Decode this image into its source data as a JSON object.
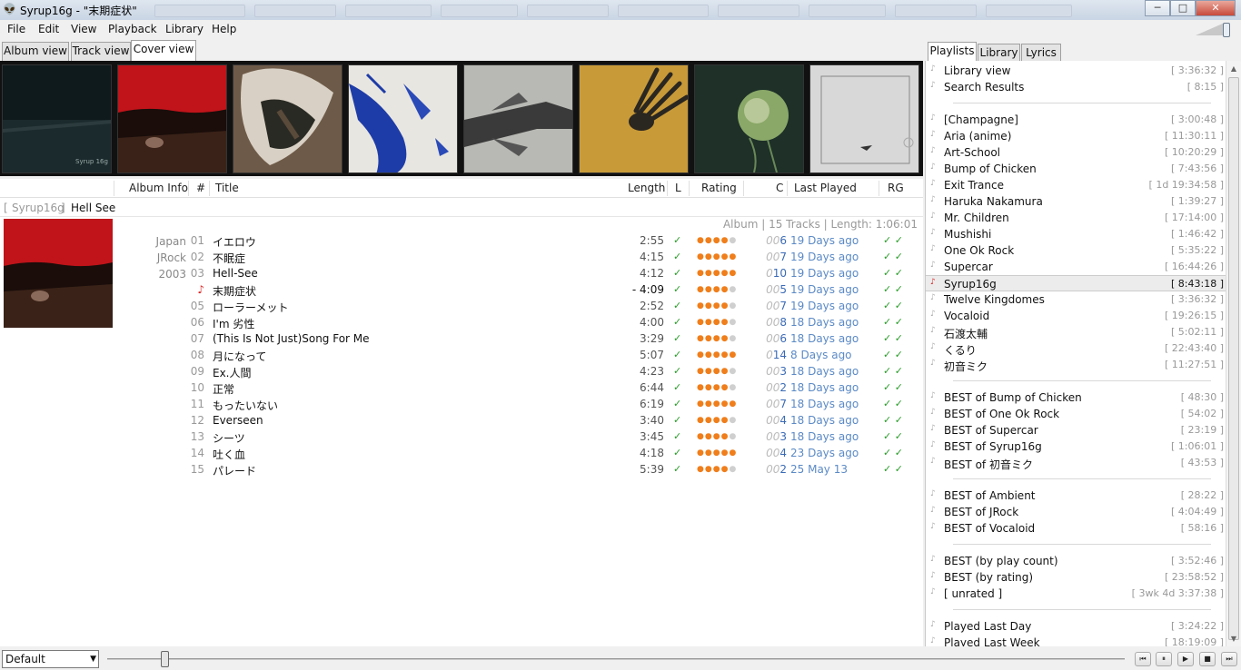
{
  "window": {
    "title": "Syrup16g  -  \"末期症状\"",
    "min": "─",
    "max": "□",
    "close": "✕"
  },
  "menu": [
    "File",
    "Edit",
    "View",
    "Playback",
    "Library",
    "Help"
  ],
  "tabs": [
    "Album view",
    "Track view",
    "Cover view"
  ],
  "active_tab": "Cover view",
  "columns": {
    "album_info": "Album Info",
    "num": "#",
    "title": "Title",
    "length": "Length",
    "l": "L",
    "rating": "Rating",
    "c": "C",
    "last_played": "Last Played",
    "rg": "RG"
  },
  "group": {
    "artist": "Syrup16g",
    "album": "Hell See",
    "left_bracket": "[",
    "right_bracket": "]"
  },
  "album_summary": "Album  |  15 Tracks  |  Length: 1:06:01",
  "album_meta": [
    "Japan",
    "JRock",
    "2003"
  ],
  "tracks": [
    {
      "n": "01",
      "title": "イエロウ",
      "len": "2:55",
      "stars": 4,
      "cz": "00",
      "c": "6",
      "lp": "19 Days ago"
    },
    {
      "n": "02",
      "title": "不眠症",
      "len": "4:15",
      "stars": 5,
      "cz": "00",
      "c": "7",
      "lp": "19 Days ago"
    },
    {
      "n": "03",
      "title": "Hell-See",
      "len": "4:12",
      "stars": 5,
      "cz": "0",
      "c": "10",
      "lp": "19 Days ago"
    },
    {
      "n": "♪",
      "title": "末期症状",
      "len": "- 4:09",
      "stars": 4,
      "cz": "00",
      "c": "5",
      "lp": "19 Days ago"
    },
    {
      "n": "05",
      "title": "ローラーメット",
      "len": "2:52",
      "stars": 4,
      "cz": "00",
      "c": "7",
      "lp": "19 Days ago"
    },
    {
      "n": "06",
      "title": "I'm 劣性",
      "len": "4:00",
      "stars": 4,
      "cz": "00",
      "c": "8",
      "lp": "18 Days ago"
    },
    {
      "n": "07",
      "title": "(This Is Not Just)Song For Me",
      "len": "3:29",
      "stars": 4,
      "cz": "00",
      "c": "6",
      "lp": "18 Days ago"
    },
    {
      "n": "08",
      "title": "月になって",
      "len": "5:07",
      "stars": 5,
      "cz": "0",
      "c": "14",
      "lp": "8 Days ago"
    },
    {
      "n": "09",
      "title": "Ex.人間",
      "len": "4:23",
      "stars": 4,
      "cz": "00",
      "c": "3",
      "lp": "18 Days ago"
    },
    {
      "n": "10",
      "title": "正常",
      "len": "6:44",
      "stars": 4,
      "cz": "00",
      "c": "2",
      "lp": "18 Days ago"
    },
    {
      "n": "11",
      "title": "もったいない",
      "len": "6:19",
      "stars": 5,
      "cz": "00",
      "c": "7",
      "lp": "18 Days ago"
    },
    {
      "n": "12",
      "title": "Everseen",
      "len": "3:40",
      "stars": 4,
      "cz": "00",
      "c": "4",
      "lp": "18 Days ago"
    },
    {
      "n": "13",
      "title": "シーツ",
      "len": "3:45",
      "stars": 4,
      "cz": "00",
      "c": "3",
      "lp": "18 Days ago"
    },
    {
      "n": "14",
      "title": "吐く血",
      "len": "4:18",
      "stars": 5,
      "cz": "00",
      "c": "4",
      "lp": "23 Days ago"
    },
    {
      "n": "15",
      "title": "パレード",
      "len": "5:39",
      "stars": 4,
      "cz": "00",
      "c": "2",
      "lp": "25  May 13"
    }
  ],
  "right_tabs": [
    "Playlists",
    "Library",
    "Lyrics"
  ],
  "playlists": [
    [
      {
        "name": "Library view",
        "dur": "[ 3:36:32 ]"
      },
      {
        "name": "Search Results",
        "dur": "[ 8:15 ]"
      }
    ],
    [
      {
        "name": "[Champagne]",
        "dur": "[ 3:00:48 ]"
      },
      {
        "name": "Aria (anime)",
        "dur": "[ 11:30:11 ]"
      },
      {
        "name": "Art-School",
        "dur": "[ 10:20:29 ]"
      },
      {
        "name": "Bump of Chicken",
        "dur": "[ 7:43:56 ]"
      },
      {
        "name": "Exit Trance",
        "dur": "[ 1d 19:34:58 ]"
      },
      {
        "name": "Haruka Nakamura",
        "dur": "[ 1:39:27 ]"
      },
      {
        "name": "Mr. Children",
        "dur": "[ 17:14:00 ]"
      },
      {
        "name": "Mushishi",
        "dur": "[ 1:46:42 ]"
      },
      {
        "name": "One Ok Rock",
        "dur": "[ 5:35:22 ]"
      },
      {
        "name": "Supercar",
        "dur": "[ 16:44:26 ]"
      },
      {
        "name": "Syrup16g",
        "dur": "[ 8:43:18 ]",
        "selected": true
      },
      {
        "name": "Twelve Kingdomes",
        "dur": "[ 3:36:32 ]"
      },
      {
        "name": "Vocaloid",
        "dur": "[ 19:26:15 ]"
      },
      {
        "name": "石渡太輔",
        "dur": "[ 5:02:11 ]"
      },
      {
        "name": "くるり",
        "dur": "[ 22:43:40 ]"
      },
      {
        "name": "初音ミク",
        "dur": "[ 11:27:51 ]"
      }
    ],
    [
      {
        "name": "BEST of Bump of Chicken",
        "dur": "[ 48:30 ]"
      },
      {
        "name": "BEST of One Ok Rock",
        "dur": "[ 54:02 ]"
      },
      {
        "name": "BEST of Supercar",
        "dur": "[ 23:19 ]"
      },
      {
        "name": "BEST of Syrup16g",
        "dur": "[ 1:06:01 ]"
      },
      {
        "name": "BEST of 初音ミク",
        "dur": "[ 43:53 ]"
      }
    ],
    [
      {
        "name": "BEST of Ambient",
        "dur": "[ 28:22 ]"
      },
      {
        "name": "BEST of JRock",
        "dur": "[ 4:04:49 ]"
      },
      {
        "name": "BEST of Vocaloid",
        "dur": "[ 58:16 ]"
      }
    ],
    [
      {
        "name": "BEST (by play count)",
        "dur": "[ 3:52:46 ]"
      },
      {
        "name": "BEST (by rating)",
        "dur": "[ 23:58:52 ]"
      },
      {
        "name": "[ unrated ]",
        "dur": "[ 3wk 4d 3:37:38 ]"
      }
    ],
    [
      {
        "name": "Played Last Day",
        "dur": "[ 3:24:22 ]"
      },
      {
        "name": "Played Last Week",
        "dur": "[ 18:19:09 ]"
      }
    ]
  ],
  "dsp": "Default",
  "playback": {
    "prev": "⏮",
    "pause": "⏸",
    "play": "▶",
    "stop": "■",
    "next": "⏭"
  },
  "seek_position": 0.05,
  "colors": {
    "star_on": "#f07e1a",
    "star_off": "#cfcfcf",
    "check": "#2a9c2a",
    "link": "#5b8ac6"
  },
  "covers": [
    "#0e1a1c",
    "#c0141a",
    "#6e5a48",
    "#e8e6e0",
    "#9a9a98",
    "#c89a38",
    "#1e3028",
    "#d8d8d8"
  ]
}
